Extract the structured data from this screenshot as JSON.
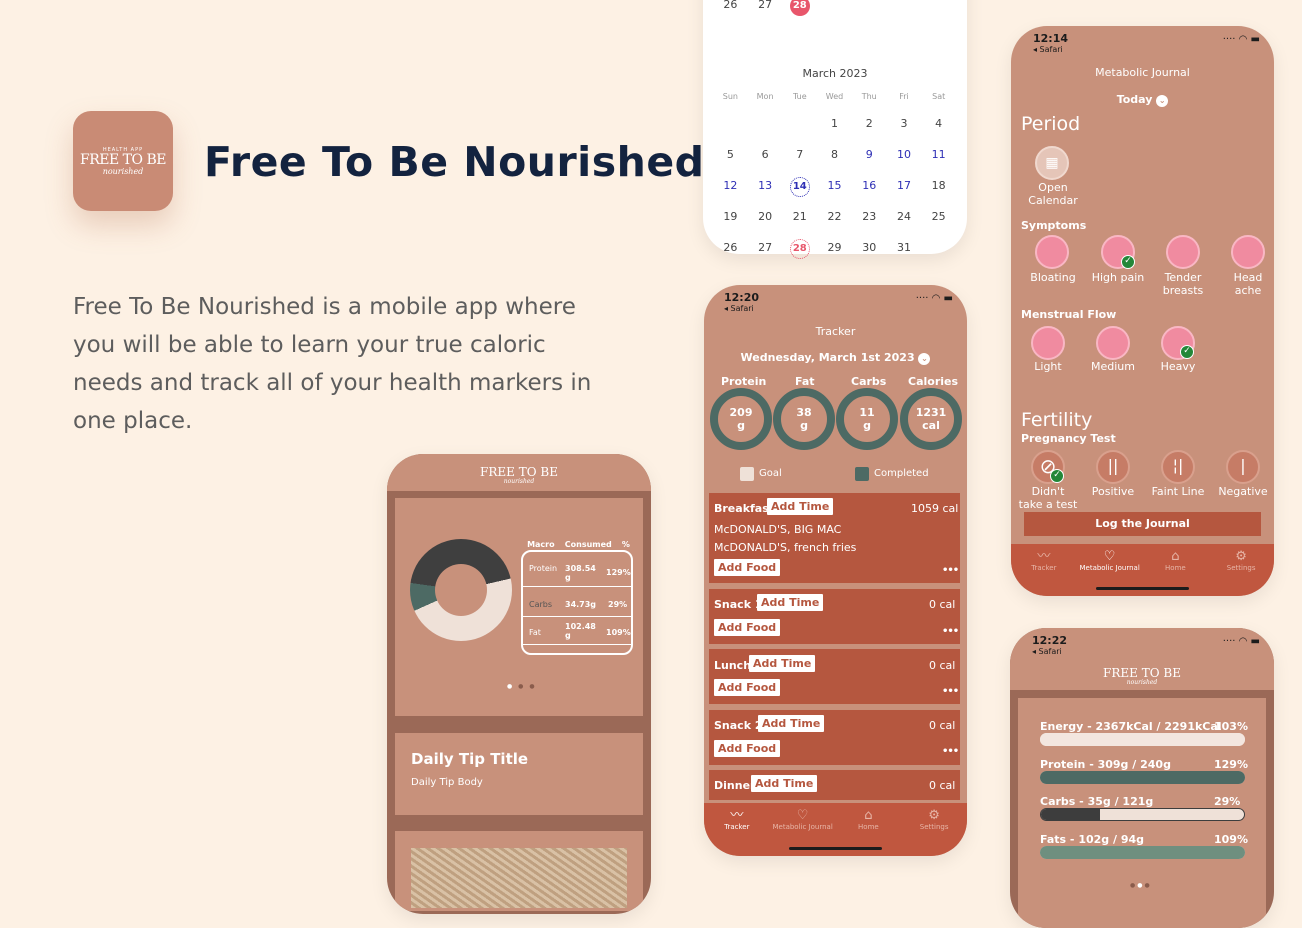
{
  "logo": {
    "small": "HEALTH APP",
    "main": "FREE TO BE",
    "script": "nourished"
  },
  "hero": {
    "title": "Free To Be Nourished",
    "description": "Free To Be Nourished is a mobile app where you will be able to learn your true caloric needs and track all of your health markers in one place."
  },
  "calendar": {
    "top_partial": [
      "26",
      "27",
      "28"
    ],
    "month": "March 2023",
    "weekdays": [
      "Sun",
      "Mon",
      "Tue",
      "Wed",
      "Thu",
      "Fri",
      "Sat"
    ],
    "rows": [
      [
        "",
        "",
        "",
        "1",
        "2",
        "3",
        "4"
      ],
      [
        "5",
        "6",
        "7",
        "8",
        "9",
        "10",
        "11"
      ],
      [
        "12",
        "13",
        "14",
        "15",
        "16",
        "17",
        "18"
      ],
      [
        "19",
        "20",
        "21",
        "22",
        "23",
        "24",
        "25"
      ],
      [
        "26",
        "27",
        "28",
        "29",
        "30",
        "31",
        ""
      ]
    ],
    "accent": "#2e2fb5",
    "highlight": "#e8566b"
  },
  "home": {
    "logo_main": "FREE TO BE",
    "logo_script": "nourished",
    "table_headers": [
      "Macro",
      "Consumed",
      "%"
    ],
    "rows": [
      {
        "macro": "Protein",
        "consumed": "308.54 g",
        "pct": "129%"
      },
      {
        "macro": "Carbs",
        "consumed": "34.73g",
        "pct": "29%"
      },
      {
        "macro": "Fat",
        "consumed": "102.48 g",
        "pct": "109%"
      }
    ],
    "tip_title": "Daily Tip Title",
    "tip_body": "Daily Tip Body"
  },
  "tracker": {
    "time": "12:20",
    "back": "◂ Safari",
    "title": "Tracker",
    "date": "Wednesday, March 1st 2023",
    "macros": [
      {
        "label": "Protein",
        "value": "209",
        "unit": "g"
      },
      {
        "label": "Fat",
        "value": "38",
        "unit": "g"
      },
      {
        "label": "Carbs",
        "value": "11",
        "unit": "g"
      },
      {
        "label": "Calories",
        "value": "1231",
        "unit": "cal"
      }
    ],
    "legend_goal": "Goal",
    "legend_completed": "Completed",
    "add_time": "Add Time",
    "add_food": "Add Food",
    "more": "•••",
    "meals": [
      {
        "name": "Breakfast",
        "cal": "1059 cal",
        "items": [
          "McDONALD'S, BIG MAC",
          "McDONALD'S, french fries"
        ]
      },
      {
        "name": "Snack 1",
        "cal": "0 cal"
      },
      {
        "name": "Lunch",
        "cal": "0 cal"
      },
      {
        "name": "Snack 2",
        "cal": "0 cal"
      },
      {
        "name": "Dinner",
        "cal": "0 cal"
      }
    ],
    "tabs": [
      "Tracker",
      "Metabolic Journal",
      "Home",
      "Settings"
    ]
  },
  "journal": {
    "time": "12:14",
    "back": "◂ Safari",
    "title": "Metabolic Journal",
    "today": "Today",
    "period": "Period",
    "open_calendar": "Open Calendar",
    "symptoms": "Symptoms",
    "symptom_items": [
      "Bloating",
      "High pain",
      "Tender breasts",
      "Head ache"
    ],
    "flow": "Menstrual Flow",
    "flow_items": [
      "Light",
      "Medium",
      "Heavy"
    ],
    "fertility": "Fertility",
    "pregnancy": "Pregnancy Test",
    "test_items": [
      "Didn't take a test",
      "Positive",
      "Faint Line",
      "Negative"
    ],
    "log_button": "Log the Journal",
    "tabs": [
      "Tracker",
      "Metabolic Journal",
      "Home",
      "Settings"
    ]
  },
  "summary": {
    "time": "12:22",
    "back": "◂ Safari",
    "logo_main": "FREE TO BE",
    "logo_script": "nourished",
    "bars": [
      {
        "label": "Energy - 2367kCal / 2291kCal",
        "pct": "103%",
        "fill": 1.0,
        "color": "#f3e6df"
      },
      {
        "label": "Protein - 309g / 240g",
        "pct": "129%",
        "fill": 1.0,
        "color": "#4d6a64"
      },
      {
        "label": "Carbs - 35g / 121g",
        "pct": "29%",
        "fill": 0.29,
        "color": "#3d3d3d"
      },
      {
        "label": "Fats - 102g / 94g",
        "pct": "109%",
        "fill": 1.0,
        "color": "#6f8f7f"
      }
    ]
  }
}
